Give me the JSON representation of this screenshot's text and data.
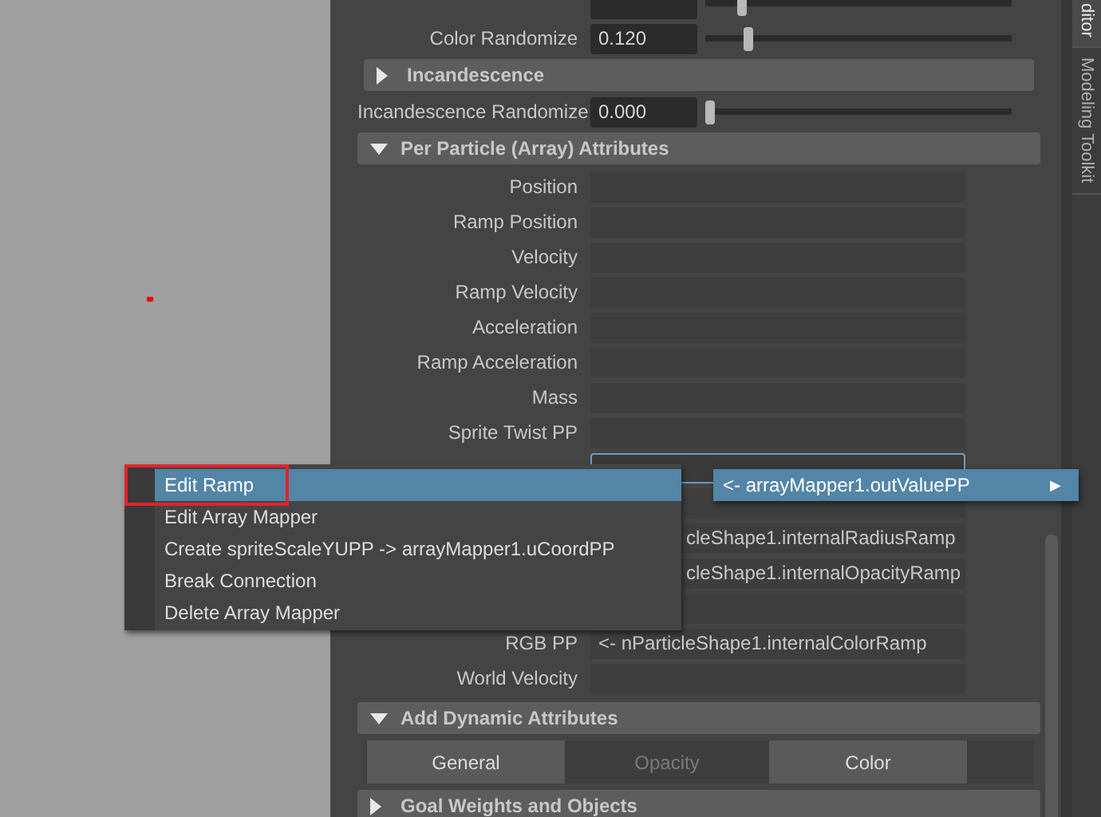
{
  "viewport": {
    "kind": "viewport"
  },
  "slider_rows": [
    {
      "level": 0.11
    },
    {
      "label": "Color Randomize",
      "value": "0.120",
      "level": 0.13
    }
  ],
  "incandescence": {
    "title": "Incandescence",
    "expanded": false,
    "slider_rows": [
      {
        "label": "Incandescence Randomize",
        "value": "0.000",
        "level": 0.0
      }
    ]
  },
  "per_particle": {
    "title": "Per Particle (Array) Attributes",
    "expanded": true,
    "rows": [
      {
        "label": "Position",
        "value": ""
      },
      {
        "label": "Ramp Position",
        "value": ""
      },
      {
        "label": "Velocity",
        "value": ""
      },
      {
        "label": "Ramp Velocity",
        "value": ""
      },
      {
        "label": "Acceleration",
        "value": ""
      },
      {
        "label": "Ramp Acceleration",
        "value": ""
      },
      {
        "label": "Mass",
        "value": ""
      },
      {
        "label": "Sprite Twist PP",
        "value": ""
      },
      {
        "label": "",
        "value": "",
        "focused": true
      },
      {
        "label": "",
        "value": ""
      },
      {
        "label": "",
        "value": "cleShape1.internalRadiusRamp"
      },
      {
        "label": "",
        "value": "cleShape1.internalOpacityRamp"
      },
      {
        "label": "",
        "value": ""
      },
      {
        "label": "RGB PP",
        "value": "<- nParticleShape1.internalColorRamp"
      },
      {
        "label": "World Velocity",
        "value": ""
      }
    ]
  },
  "add_dynamic": {
    "title": "Add Dynamic Attributes",
    "expanded": true,
    "buttons": [
      {
        "label": "General",
        "disabled": false
      },
      {
        "label": "Opacity",
        "disabled": true
      },
      {
        "label": "Color",
        "disabled": false
      }
    ]
  },
  "goal_weights": {
    "title": "Goal Weights and Objects",
    "expanded": false
  },
  "side_tabs": [
    {
      "label": "ditor",
      "selected": true
    },
    {
      "label": "Modeling Toolkit",
      "selected": false
    }
  ],
  "context_menu": {
    "items": [
      {
        "label": "Edit Ramp",
        "selected": true
      },
      {
        "label": "Edit Array Mapper",
        "selected": false
      },
      {
        "label": "Create spriteScaleYUPP -> arrayMapper1.uCoordPP",
        "selected": false
      },
      {
        "label": "Break Connection",
        "selected": false
      },
      {
        "label": "Delete Array Mapper",
        "selected": false
      }
    ],
    "submenu": {
      "label": "<- arrayMapper1.outValuePP",
      "arrow": "▶"
    }
  }
}
